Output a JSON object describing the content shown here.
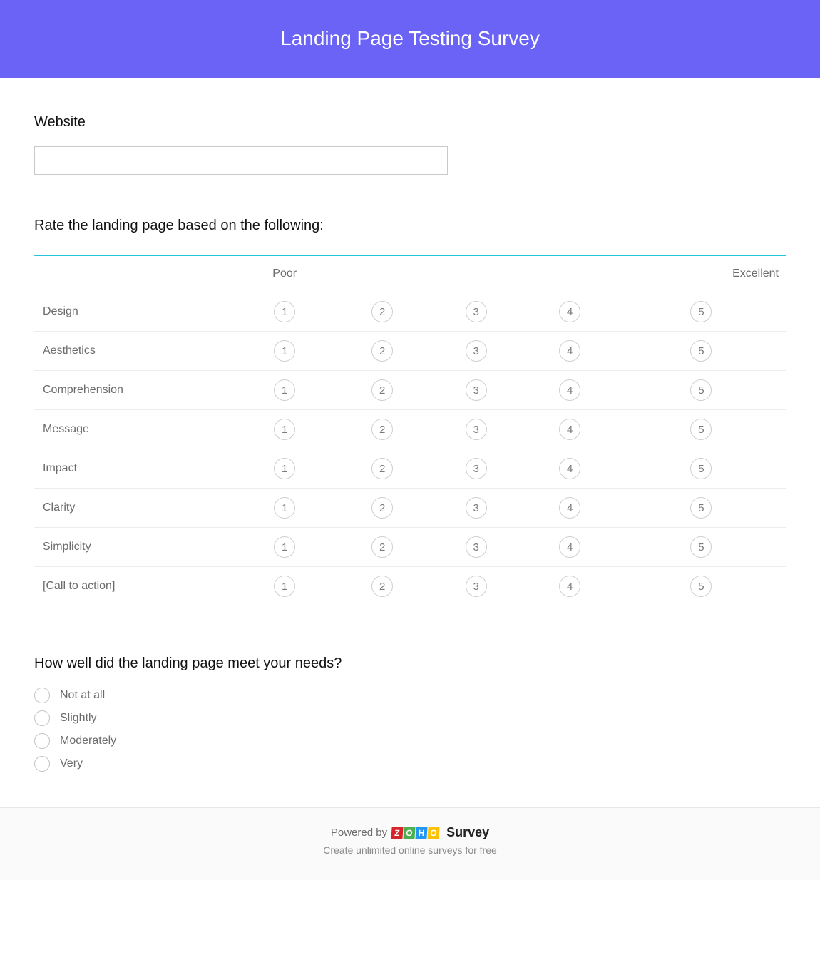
{
  "header": {
    "title": "Landing Page Testing Survey"
  },
  "q1": {
    "label": "Website",
    "value": ""
  },
  "q2": {
    "label": "Rate the landing page based on the following:",
    "scale_low": "Poor",
    "scale_high": "Excellent",
    "columns": [
      "1",
      "2",
      "3",
      "4",
      "5"
    ],
    "rows": [
      "Design",
      "Aesthetics",
      "Comprehension",
      "Message",
      "Impact",
      "Clarity",
      "Simplicity",
      "[Call to action]"
    ]
  },
  "q3": {
    "label": "How well did the landing page meet your needs?",
    "options": [
      "Not at all",
      "Slightly",
      "Moderately",
      "Very"
    ]
  },
  "footer": {
    "powered_by": "Powered by",
    "brand_suffix": "Survey",
    "tagline": "Create unlimited online surveys for free"
  }
}
